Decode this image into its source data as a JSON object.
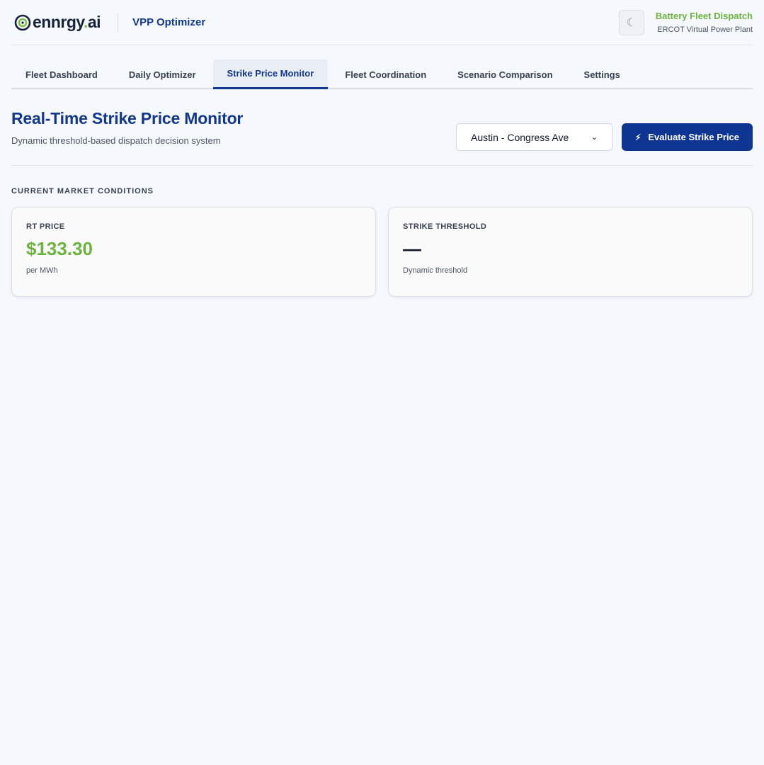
{
  "header": {
    "logo_text": "ennrgy",
    "logo_dot": ".",
    "logo_suffix": "ai",
    "app_name": "VPP Optimizer",
    "theme_icon": "moon-icon",
    "fleet_title": "Battery Fleet Dispatch",
    "fleet_subtitle": "ERCOT Virtual Power Plant"
  },
  "tabs": [
    {
      "label": "Fleet Dashboard",
      "active": false
    },
    {
      "label": "Daily Optimizer",
      "active": false
    },
    {
      "label": "Strike Price Monitor",
      "active": true
    },
    {
      "label": "Fleet Coordination",
      "active": false
    },
    {
      "label": "Scenario Comparison",
      "active": false
    },
    {
      "label": "Settings",
      "active": false
    }
  ],
  "main": {
    "title": "Real-Time Strike Price Monitor",
    "subtitle": "Dynamic threshold-based dispatch decision system",
    "site_select": {
      "value": "Austin - Congress Ave"
    },
    "evaluate_button": {
      "label": "Evaluate Strike Price",
      "icon": "bolt-icon"
    },
    "section_label": "CURRENT MARKET CONDITIONS",
    "cards": [
      {
        "label": "RT PRICE",
        "value": "$133.30",
        "note": "per MWh"
      },
      {
        "label": "STRIKE THRESHOLD",
        "value": "—",
        "note": "Dynamic threshold"
      }
    ]
  },
  "colors": {
    "brand_blue": "#13378c",
    "button_blue": "#0e3592",
    "accent_green": "#6cb43f",
    "background": "#f5f8fc"
  }
}
